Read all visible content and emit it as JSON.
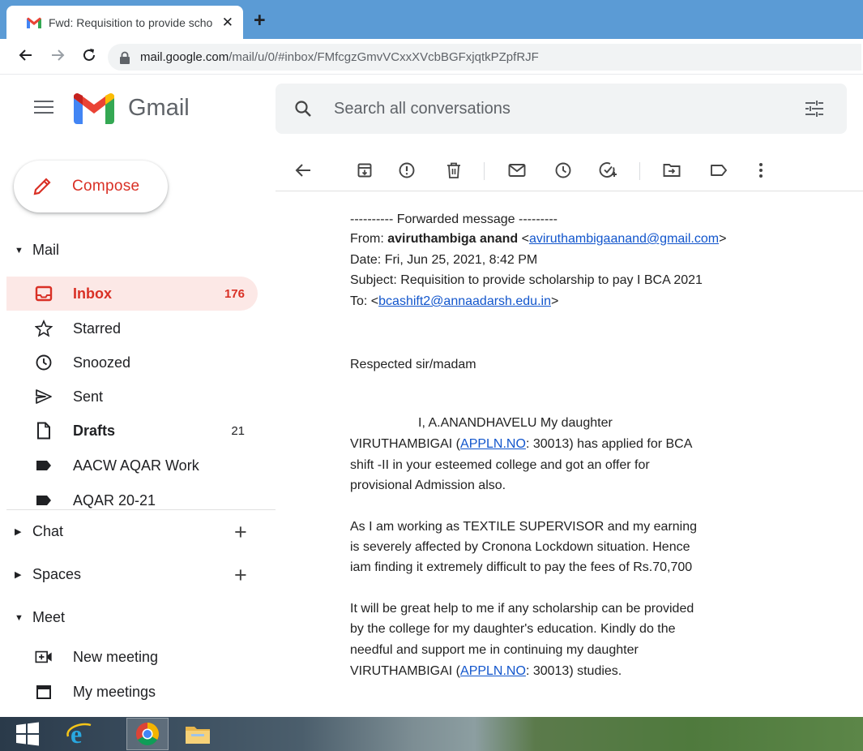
{
  "browser": {
    "tab_title": "Fwd: Requisition to provide scho",
    "tab_close": "✕",
    "new_tab": "+",
    "url_host": "mail.google.com",
    "url_path": "/mail/u/0/#inbox/FMfcgzGmvVCxxXVcbBGFxjqtkPZpfRJF"
  },
  "gmail": {
    "brand": "Gmail",
    "search_placeholder": "Search all conversations",
    "compose_label": "Compose"
  },
  "sidebar": {
    "mail_label": "Mail",
    "items": [
      {
        "label": "Inbox",
        "count": "176"
      },
      {
        "label": "Starred",
        "count": ""
      },
      {
        "label": "Snoozed",
        "count": ""
      },
      {
        "label": "Sent",
        "count": ""
      },
      {
        "label": "Drafts",
        "count": "21"
      },
      {
        "label": "AACW AQAR Work",
        "count": ""
      },
      {
        "label": "AQAR 20-21",
        "count": ""
      }
    ],
    "chat_label": "Chat",
    "spaces_label": "Spaces",
    "meet_label": "Meet",
    "meet_items": [
      {
        "label": "New meeting"
      },
      {
        "label": "My meetings"
      }
    ]
  },
  "message": {
    "forward_header": "---------- Forwarded message ---------",
    "from_prefix": "From: ",
    "from_name": "aviruthambiga anand",
    "from_email_open": " <",
    "from_email": "aviruthambigaanand@gmail.com",
    "from_email_close": ">",
    "date": "Date: Fri, Jun 25, 2021, 8:42 PM",
    "subject": "Subject: Requisition to provide scholarship to pay I BCA 2021",
    "to_prefix": "To: <",
    "to_email": "bcashift2@annaadarsh.edu.in",
    "to_suffix": ">",
    "greeting": "Respected sir/madam",
    "p1_line1": "I, A.ANANDHAVELU My daughter",
    "p1_line2_a": "VIRUTHAMBIGAI (",
    "p1_line2_link": "APPLN.NO",
    "p1_line2_b": ": 30013) has applied for BCA",
    "p1_line3": "shift -II in your esteemed college and got an offer for",
    "p1_line4": "provisional Admission also.",
    "p2_line1": "As I am working as TEXTILE SUPERVISOR and my earning",
    "p2_line2": "is severely affected by Cronona Lockdown situation. Hence",
    "p2_line3": "iam finding it extremely difficult to pay the fees of Rs.70,700",
    "p3_line1": "It will be great help to me if any scholarship can be provided",
    "p3_line2": "by the college for my daughter's education.  Kindly do the",
    "p3_line3": "needful and support me in continuing my daughter",
    "p3_line4_a": "VIRUTHAMBIGAI (",
    "p3_line4_link": "APPLN.NO",
    "p3_line4_b": ": 30013) studies."
  },
  "colors": {
    "tabstrip": "#5b9bd5",
    "gmail_red": "#d93025",
    "link_blue": "#1155cc",
    "active_bg": "#fce8e6"
  }
}
